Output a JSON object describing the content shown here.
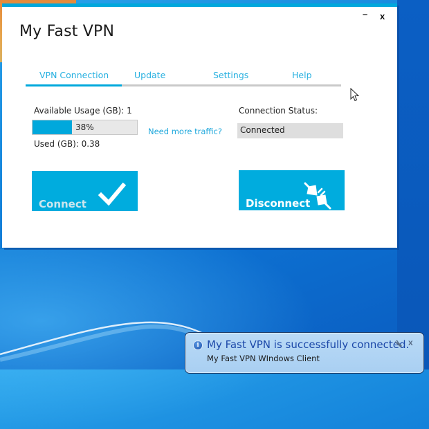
{
  "window": {
    "title": "My Fast VPN",
    "minimize_glyph": "–",
    "close_glyph": "x",
    "accent_color": "#00a8dc"
  },
  "tabs": [
    {
      "label": "VPN Connection",
      "active": true
    },
    {
      "label": "Update",
      "active": false
    },
    {
      "label": "Settings",
      "active": false
    },
    {
      "label": "Help",
      "active": false
    }
  ],
  "usage": {
    "available_label": "Available Usage (GB): 1",
    "progress_percent": 38,
    "progress_text": "38%",
    "used_label": "Used (GB): 0.38",
    "more_traffic_link": "Need more traffic?"
  },
  "status": {
    "label": "Connection Status:",
    "value": "Connected"
  },
  "buttons": {
    "connect": {
      "label": "Connect",
      "icon": "checkmark-icon",
      "enabled": false
    },
    "disconnect": {
      "label": "Disconnect",
      "icon": "unplug-icon",
      "enabled": true
    }
  },
  "notification": {
    "icon": "info-icon",
    "info_glyph": "i",
    "title": "My Fast VPN is successfully connected.",
    "subtitle": "My Fast VPN WIndows Client",
    "close_glyph": "x"
  }
}
